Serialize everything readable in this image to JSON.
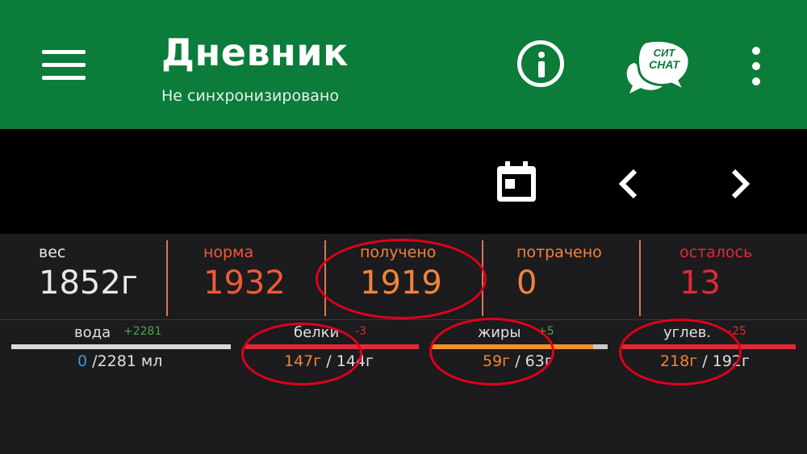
{
  "app_bar": {
    "title": "Дневник",
    "subtitle": "Не синхронизировано",
    "chat_badge_line1": "СИТ",
    "chat_badge_line2": "CHAT",
    "color": "#0b7c3a"
  },
  "toolbar": {
    "icons": [
      "calendar-icon",
      "chevron-left-icon",
      "chevron-right-icon"
    ]
  },
  "stats": [
    {
      "label": "вес",
      "value": "1852г",
      "color": "#e8e8e8"
    },
    {
      "label": "норма",
      "value": "1932",
      "color": "#f05a38"
    },
    {
      "label": "получено",
      "value": "1919",
      "color": "#f0843c"
    },
    {
      "label": "потрачено",
      "value": "0",
      "color": "#f0843c"
    },
    {
      "label": "осталось",
      "value": "13",
      "color": "#e02a36"
    }
  ],
  "macros": [
    {
      "name": "вода",
      "delta": "+2281",
      "consumed": "0",
      "target": "/2281 мл",
      "progress": 1.0,
      "bar_color": "#d9d9d9"
    },
    {
      "name": "белки",
      "delta": "-3",
      "consumed": "147г",
      "target": "/ 144г",
      "progress": 1.0,
      "bar_color": "#e02a36"
    },
    {
      "name": "жиры",
      "delta": "+5",
      "consumed": "59г",
      "target": "/ 63г",
      "progress": 0.92,
      "bar_color": "#f0922a"
    },
    {
      "name": "углев.",
      "delta": "-25",
      "consumed": "218г",
      "target": "/ 192г",
      "progress": 1.0,
      "bar_color": "#e02a36"
    }
  ]
}
